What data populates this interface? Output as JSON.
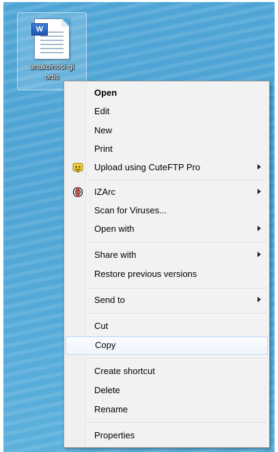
{
  "desktop": {
    "file": {
      "label_line1": "anakoinosi-gi",
      "label_line2": "ortis",
      "icon": "word-document-icon",
      "badge": "W"
    }
  },
  "context_menu": {
    "items": [
      {
        "label": "Open"
      },
      {
        "label": "Edit"
      },
      {
        "label": "New"
      },
      {
        "label": "Print"
      },
      {
        "label": "Upload using CuteFTP Pro",
        "icon": "cuteftp-icon"
      },
      {
        "label": "IZArc",
        "icon": "izarc-icon"
      },
      {
        "label": "Scan for Viruses..."
      },
      {
        "label": "Open with"
      },
      {
        "label": "Share with"
      },
      {
        "label": "Restore previous versions"
      },
      {
        "label": "Send to"
      },
      {
        "label": "Cut"
      },
      {
        "label": "Copy"
      },
      {
        "label": "Create shortcut"
      },
      {
        "label": "Delete"
      },
      {
        "label": "Rename"
      },
      {
        "label": "Properties"
      }
    ]
  },
  "colors": {
    "desktop_blue": "#4fa6d6",
    "menu_bg": "#f2f2f2",
    "selection_border": "#b8d6fb"
  }
}
